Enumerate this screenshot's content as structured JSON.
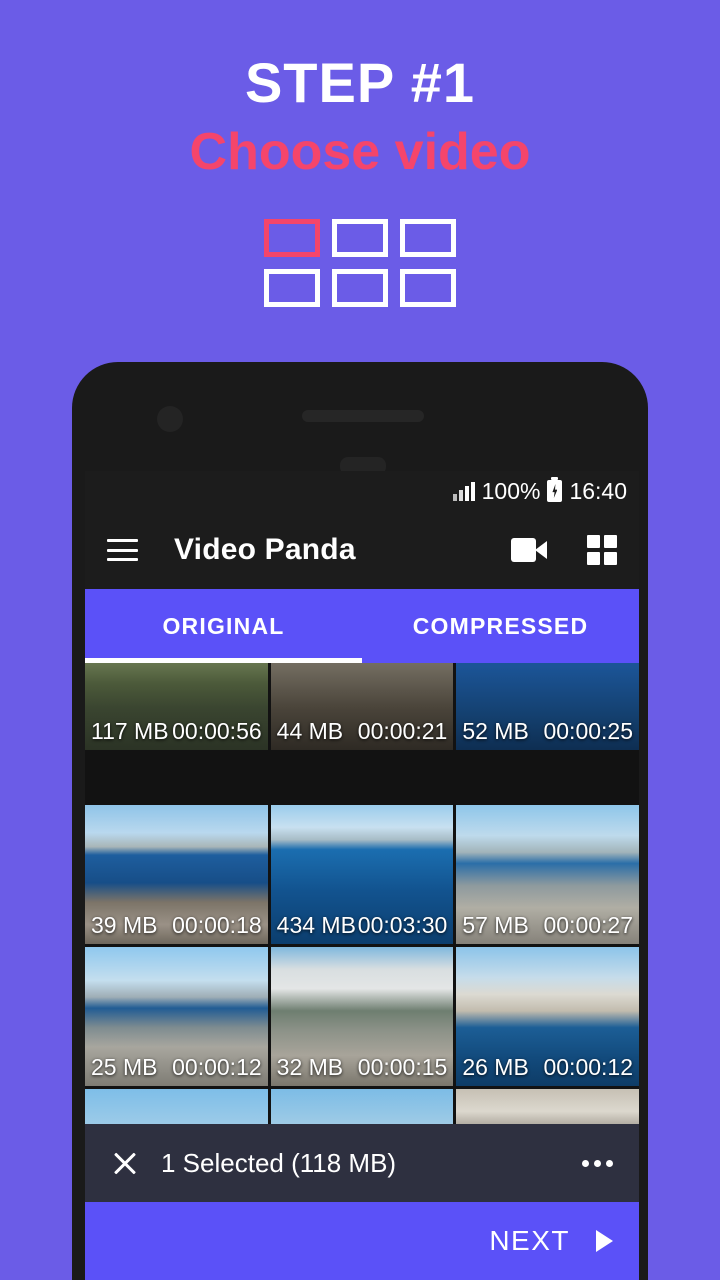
{
  "promo": {
    "step_title": "STEP #1",
    "subtitle": "Choose video",
    "grid_icon": "grid-illustration",
    "cells": [
      {
        "accent": true
      },
      {
        "accent": false
      },
      {
        "accent": false
      },
      {
        "accent": false
      },
      {
        "accent": false
      },
      {
        "accent": false
      }
    ],
    "colors": {
      "background": "#6B5CE7",
      "step_text": "#FFFFFF",
      "subtitle_text": "#F5456B",
      "accent_cell": "#F5456B"
    }
  },
  "statusbar": {
    "signal_icon": "signal-bars-icon",
    "battery_percent": "100%",
    "battery_icon": "battery-charging-icon",
    "time": "16:40"
  },
  "appbar": {
    "menu_icon": "hamburger-menu-icon",
    "title": "Video Panda",
    "camera_icon": "video-camera-icon",
    "grid_icon": "grid-view-icon",
    "background": "#1C1C1C"
  },
  "tabs": {
    "items": [
      {
        "label": "ORIGINAL",
        "active": true
      },
      {
        "label": "COMPRESSED",
        "active": false
      }
    ],
    "accent": "#5B51F8",
    "indicator_color": "#FFFFFF"
  },
  "videogrid": {
    "items": [
      {
        "size": "117 MB",
        "duration": "00:00:56",
        "photo": "ph-road",
        "selected": true
      },
      {
        "size": "44 MB",
        "duration": "00:00:21",
        "photo": "ph-asphalt",
        "selected": false
      },
      {
        "size": "52 MB",
        "duration": "00:00:25",
        "photo": "ph-water-dark",
        "selected": false
      },
      {
        "size": "39 MB",
        "duration": "00:00:18",
        "photo": "ph-coast1",
        "selected": false
      },
      {
        "size": "434 MB",
        "duration": "00:03:30",
        "photo": "ph-bay",
        "selected": false
      },
      {
        "size": "57 MB",
        "duration": "00:00:27",
        "photo": "ph-coast2",
        "selected": false
      },
      {
        "size": "25 MB",
        "duration": "00:00:12",
        "photo": "ph-harbor1",
        "selected": false
      },
      {
        "size": "32 MB",
        "duration": "00:00:15",
        "photo": "ph-boats",
        "selected": false
      },
      {
        "size": "26 MB",
        "duration": "00:00:12",
        "photo": "ph-town1",
        "selected": false
      },
      {
        "size": "",
        "duration": "",
        "photo": "ph-town2",
        "selected": false
      },
      {
        "size": "",
        "duration": "",
        "photo": "ph-town3",
        "selected": false
      },
      {
        "size": "",
        "duration": "",
        "photo": "ph-car",
        "selected": false
      }
    ]
  },
  "selectionbar": {
    "close_icon": "close-x-icon",
    "status": "1 Selected (118 MB)",
    "overflow_icon": "more-options-icon",
    "background": "#2E3040"
  },
  "nextbar": {
    "label": "NEXT",
    "arrow_icon": "play-arrow-icon",
    "background": "#5B51F8"
  },
  "phone": {
    "camera_icon": "front-camera-icon",
    "speaker_icon": "earpiece-speaker-icon",
    "sensor_icon": "proximity-sensor-icon"
  }
}
